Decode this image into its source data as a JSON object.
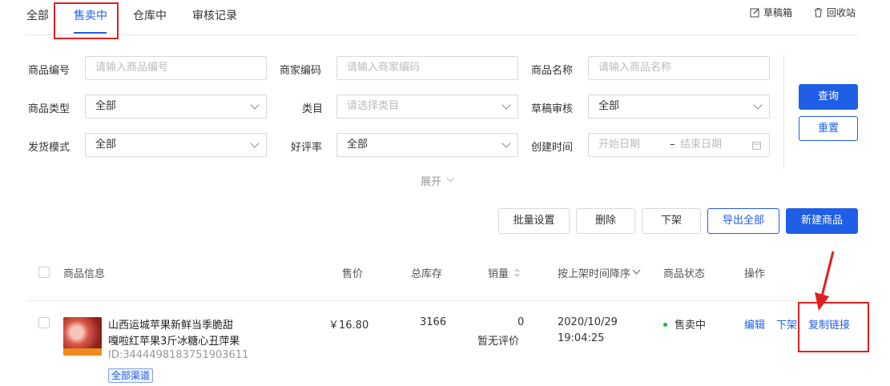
{
  "tabs": [
    {
      "label": "全部"
    },
    {
      "label": "售卖中"
    },
    {
      "label": "仓库中"
    },
    {
      "label": "审核记录"
    }
  ],
  "tools": {
    "drafts": "草稿箱",
    "recycle": "回收站"
  },
  "filters": {
    "product_no": {
      "label": "商品编号",
      "placeholder": "请输入商品编号"
    },
    "merchant_code": {
      "label": "商家编码",
      "placeholder": "请输入商家编码"
    },
    "product_name": {
      "label": "商品名称",
      "placeholder": "请输入商品名称"
    },
    "product_type": {
      "label": "商品类型",
      "value": "全部"
    },
    "category": {
      "label": "类目",
      "placeholder": "请选择类目"
    },
    "draft_review": {
      "label": "草稿审核",
      "value": "全部"
    },
    "shipping_mode": {
      "label": "发货模式",
      "value": "全部"
    },
    "rating": {
      "label": "好评率",
      "value": "全部"
    },
    "created_time": {
      "label": "创建时间",
      "start_placeholder": "开始日期",
      "sep": "–",
      "end_placeholder": "结束日期"
    },
    "expand_label": "展开"
  },
  "buttons": {
    "query": "查询",
    "reset": "重置",
    "batch": "批量设置",
    "delete": "删除",
    "delist": "下架",
    "export_all": "导出全部",
    "new_product": "新建商品"
  },
  "table": {
    "headers": {
      "info": "商品信息",
      "price": "售价",
      "stock": "总库存",
      "sales": "销量",
      "sort": "按上架时间降序",
      "status": "商品状态",
      "actions": "操作"
    },
    "rows": [
      {
        "title_line1": "山西运城苹果新鲜当季脆甜",
        "title_line2": "嘎啦红苹果3斤冰糖心丑萍果",
        "id": "ID:3444498183751903611",
        "channel": "全部渠道",
        "price": "￥16.80",
        "stock": "3166",
        "sales": "0",
        "rating": "暂无评价",
        "date": "2020/10/29",
        "time": "19:04:25",
        "status": "售卖中",
        "status_color": "#22b14c",
        "actions": {
          "edit": "编辑",
          "delist": "下架",
          "copy_link": "复制链接"
        }
      }
    ]
  },
  "colors": {
    "accent": "#1f5ee6",
    "annotation": "#e02020"
  }
}
